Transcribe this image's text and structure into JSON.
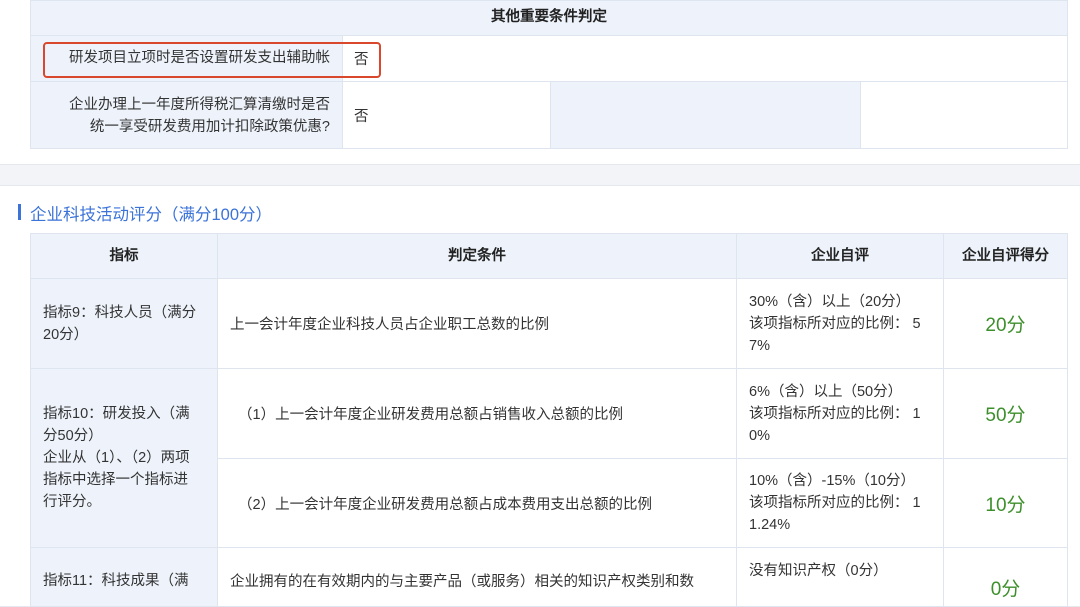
{
  "conditions_table": {
    "header": "其他重要条件判定",
    "rows": [
      {
        "label": "研发项目立项时是否设置研发支出辅助帐",
        "value": "否"
      },
      {
        "label_line1": "企业办理上一年度所得税汇算清缴时是否",
        "label_line2": "统一享受研发费用加计扣除政策优惠?",
        "value": "否"
      }
    ]
  },
  "section": {
    "title": "企业科技活动评分（满分100分）"
  },
  "score_table": {
    "columns": [
      "指标",
      "判定条件",
      "企业自评",
      "企业自评得分"
    ],
    "rows": [
      {
        "indicator": [
          "指标9：科技人员（满分",
          "20分）"
        ],
        "condition": "上一会计年度企业科技人员占企业职工总数的比例",
        "self_eval": [
          "30%（含）以上（20分）",
          "该项指标所对应的比例： 5",
          "7%"
        ],
        "score": "20分"
      },
      {
        "indicator": [
          "指标10：研发投入（满",
          "分50分）",
          "企业从（1）、（2）两项",
          "指标中选择一个指标进",
          "行评分。"
        ],
        "condition": "（1）上一会计年度企业研发费用总额占销售收入总额的比例",
        "self_eval": [
          "6%（含）以上（50分）",
          "该项指标所对应的比例： 1",
          "0%"
        ],
        "score": "50分"
      },
      {
        "condition": "（2）上一会计年度企业研发费用总额占成本费用支出总额的比例",
        "self_eval": [
          "10%（含）-15%（10分）",
          "该项指标所对应的比例： 1",
          "1.24%"
        ],
        "score": "10分"
      },
      {
        "indicator": [
          "指标11：科技成果（满"
        ],
        "condition": "企业拥有的在有效期内的与主要产品（或服务）相关的知识产权类别和数",
        "self_eval": [
          "没有知识产权（0分）"
        ],
        "score": "0分"
      }
    ]
  },
  "colors": {
    "accent": "#3b73d9",
    "score_green": "#3d8f2c",
    "highlight_red": "#d9482c",
    "header_bg": "#eef3fb"
  }
}
